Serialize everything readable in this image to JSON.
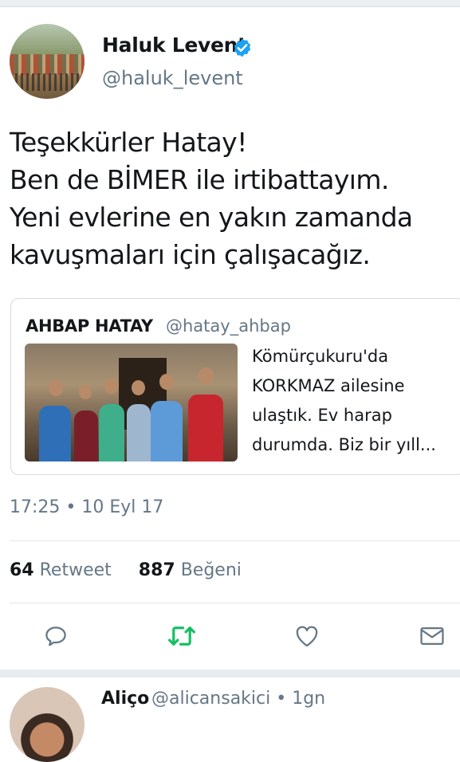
{
  "tweet": {
    "display_name": "Haluk Levent",
    "handle": "@haluk_levent",
    "text_lines": [
      "Teşekkürler Hatay!",
      "Ben de BİMER ile irtibattayım.",
      "Yeni evlerine en yakın zamanda",
      "kavuşmaları için çalışacağız."
    ],
    "timestamp": "17:25 • 10 Eyl 17"
  },
  "quoted_tweet": {
    "display_name": "AHBAP HATAY",
    "handle": "@hatay_ahbap",
    "text_lines": [
      "Kömürçukuru'da",
      "KORKMAZ ailesine",
      "ulaştık. Ev harap",
      "durumda. Biz bir yıll..."
    ]
  },
  "stats": {
    "retweets_count": "64",
    "retweets_label": "Retweet",
    "likes_count": "887",
    "likes_label": "Beğeni"
  },
  "actions": {
    "reply_icon": "reply-icon",
    "retweet_icon": "retweet-icon",
    "like_icon": "heart-icon",
    "dm_icon": "envelope-icon"
  },
  "reply": {
    "display_name": "Aliço",
    "handle_time": "@alicansakici • 1gn"
  },
  "colors": {
    "verified": "#1da1f2",
    "retweet_green": "#17bf63",
    "secondary_text": "#657786",
    "divider": "#e1e8ed"
  }
}
